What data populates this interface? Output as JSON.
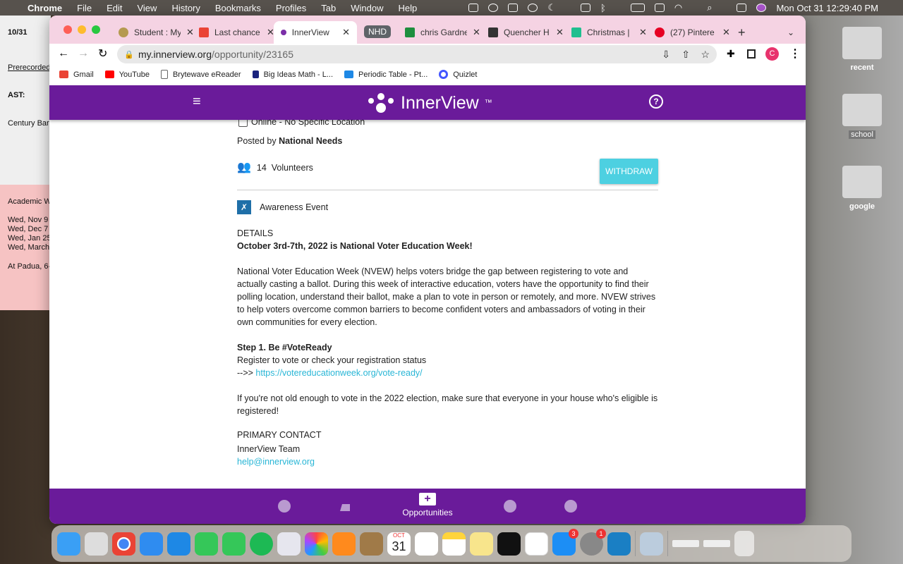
{
  "menubar": {
    "app": "Chrome",
    "items": [
      "File",
      "Edit",
      "View",
      "History",
      "Bookmarks",
      "Profiles",
      "Tab",
      "Window",
      "Help"
    ],
    "clock": "Mon Oct 31  12:29:40 PM"
  },
  "background_doc": {
    "date": "10/31",
    "prerecorded": "Prerecorded",
    "ast": "AST:",
    "century": "Century Barr",
    "academic": "Academic W",
    "dates": [
      "Wed, Nov 9",
      "Wed, Dec 7",
      "Wed, Jan 25",
      "Wed, March"
    ],
    "padua": "At Padua, 6-"
  },
  "desktop": {
    "folders": [
      "recent",
      "school",
      "google"
    ]
  },
  "tabs": [
    {
      "label": "Student : My"
    },
    {
      "label": "Last chance"
    },
    {
      "label": "InnerView",
      "active": true
    },
    {
      "label": "NHD",
      "group": true
    },
    {
      "label": "chris Gardne"
    },
    {
      "label": "Quencher H"
    },
    {
      "label": "Christmas |"
    },
    {
      "label": "(27) Pintere"
    }
  ],
  "address": {
    "host": "my.innerview.org",
    "path": "/opportunity/23165"
  },
  "profile_initial": "C",
  "bookmarks": [
    "Gmail",
    "YouTube",
    "Brytewave eReader",
    "Big Ideas Math - L...",
    "Periodic Table - Pt...",
    "Quizlet"
  ],
  "app": {
    "brand": "InnerView",
    "tm": "™",
    "accent": "#6a1b9a",
    "button_color": "#4dd0e1"
  },
  "opportunity": {
    "location": "Online - No Specific Location",
    "posted_by_label": "Posted by",
    "posted_by": "National Needs",
    "volunteers_count": "14",
    "volunteers_label": "Volunteers",
    "withdraw": "WITHDRAW",
    "category": "Awareness Event",
    "details_heading": "DETAILS",
    "headline": "October 3rd-7th, 2022 is National Voter Education Week!",
    "paragraph": "National Voter Education Week (NVEW) helps voters bridge the gap between registering to vote and actually casting a ballot. During this week of interactive education, voters have the opportunity to find their polling location, understand their ballot, make a plan to vote in person or remotely, and more. NVEW strives to help voters overcome common barriers to become confident voters and ambassadors of voting in their own communities for every election.",
    "step_title": "Step 1. Be #VoteReady",
    "step_text": "Register to vote or check your registration status",
    "arrow": "-->> ",
    "link": "https://votereducationweek.org/vote-ready/",
    "note": "If you're not old enough to vote in the 2022 election, make sure that everyone in your house who's eligible is registered!",
    "contact_heading": "PRIMARY CONTACT",
    "contact_name": "InnerView Team",
    "contact_email": "help@innerview.org"
  },
  "bottom_nav": {
    "active_label": "Opportunities"
  },
  "dock": {
    "calendar_month": "OCT",
    "calendar_day": "31",
    "appstore_badge": "3",
    "settings_badge": "1"
  }
}
